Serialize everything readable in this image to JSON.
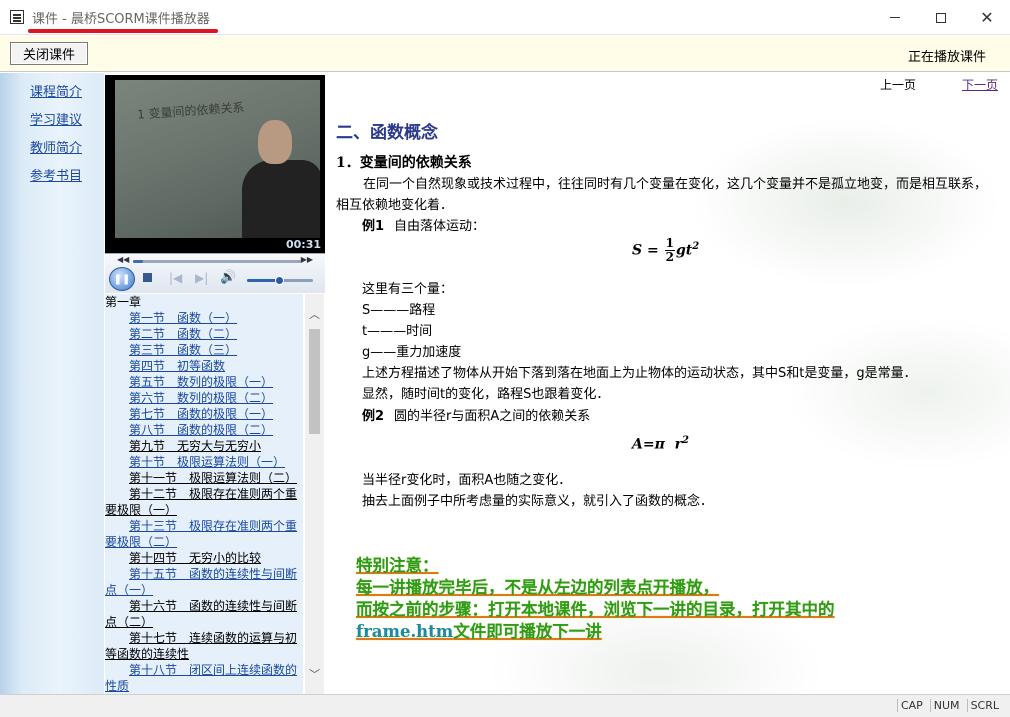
{
  "window": {
    "title": "课件 - 晨桥SCORM课件播放器",
    "controls": [
      "minimize",
      "maximize",
      "close"
    ]
  },
  "toolbar": {
    "close_button": "关闭课件",
    "status": "正在播放课件"
  },
  "leftnav": {
    "items": [
      {
        "label": "课程简介"
      },
      {
        "label": "学习建议"
      },
      {
        "label": "教师简介"
      },
      {
        "label": "参考书目"
      }
    ]
  },
  "video": {
    "board_text": "1  变量间的依赖关系",
    "time": "00:31"
  },
  "player": {
    "progress": 0.06,
    "volume": 0.5,
    "icons": [
      "play-pause-icon",
      "stop-icon",
      "previous-icon",
      "next-icon",
      "volume-icon"
    ]
  },
  "toc": {
    "chapter": "第一章",
    "items": [
      {
        "label": "第一节　函数（一）",
        "style": "link"
      },
      {
        "label": "第二节　函数（二）",
        "style": "link"
      },
      {
        "label": "第三节　函数（三）",
        "style": "link"
      },
      {
        "label": "第四节　初等函数",
        "style": "link"
      },
      {
        "label": "第五节　数列的极限（一）",
        "style": "link"
      },
      {
        "label": "第六节　数列的极限（二）",
        "style": "link"
      },
      {
        "label": "第七节　函数的极限（一）",
        "style": "link"
      },
      {
        "label": "第八节　函数的极限（二）",
        "style": "link"
      },
      {
        "label": "第九节　无穷大与无穷小",
        "style": "plain"
      },
      {
        "label": "第十节　极限运算法则（一）",
        "style": "link"
      },
      {
        "label": "第十一节　极限运算法则（二）",
        "style": "plain"
      },
      {
        "label": "第十二节　极限存在准则两个重要极限（一）",
        "style": "plain-wrap"
      },
      {
        "label": "第十三节　极限存在准则两个重要极限（二）",
        "style": "link-wrap"
      },
      {
        "label": "第十四节　无穷小的比较",
        "style": "plain"
      },
      {
        "label": "第十五节　函数的连续性与间断点（一）",
        "style": "link-wrap"
      },
      {
        "label": "第十六节　函数的连续性与间断点（二）",
        "style": "plain-wrap"
      },
      {
        "label": "第十七节　连续函数的运算与初等函数的连续性",
        "style": "plain-wrap"
      },
      {
        "label": "第十八节　闭区间上连续函数的性质",
        "style": "link-wrap"
      }
    ]
  },
  "content": {
    "pager": {
      "prev": "上一页",
      "next": "下一页"
    },
    "heading": "二、函数概念",
    "section": "1．变量间的依赖关系",
    "paragraph": "在同一个自然现象或技术过程中，往往同时有几个变量在变化，这几个变量并不是孤立地变，而是相互联系，相互依赖地变化着．",
    "example1_label": "例1",
    "example1_text": "自由落体运动：",
    "formula1": {
      "lhs": "S",
      "eq": "=",
      "num": "1",
      "den": "2",
      "rest": "gt",
      "exp": "2"
    },
    "vars_intro": "这里有三个量：",
    "var_s": "S———路程",
    "var_t": "t———时间",
    "var_g": "g——重力加速度",
    "explain1": "上述方程描述了物体从开始下落到落在地面上为止物体的运动状态，其中S和t是变量，g是常量．",
    "explain2": "显然，随时间t的变化，路程S也跟着变化．",
    "example2_label": "例2",
    "example2_text": "圆的半径r与面积A之间的依赖关系",
    "formula2": {
      "lhs": "A",
      "eq": "=",
      "pi": "π",
      "r": "r",
      "exp": "2"
    },
    "explain3": "当半径r变化时，面积A也随之变化．",
    "explain4": "抽去上面例子中所考虑量的实际意义，就引入了函数的概念．",
    "notice": {
      "line1": "特别注意：",
      "line2": "每一讲播放完毕后，不是从左边的列表点开播放，",
      "line3": "而按之前的步骤：打开本地课件，浏览下一讲的目录，打开其中的",
      "line4a": "frame.htm",
      "line4b": "文件即可播放下一讲"
    }
  },
  "statusbar": {
    "cap": "CAP",
    "num": "NUM",
    "scrl": "SCRL"
  },
  "colors": {
    "heading": "#2b3a8c",
    "link": "#1a4aa0",
    "notice_green": "#2f9a1d",
    "notice_underline": "#e07818",
    "title_underline": "#e0141e"
  }
}
